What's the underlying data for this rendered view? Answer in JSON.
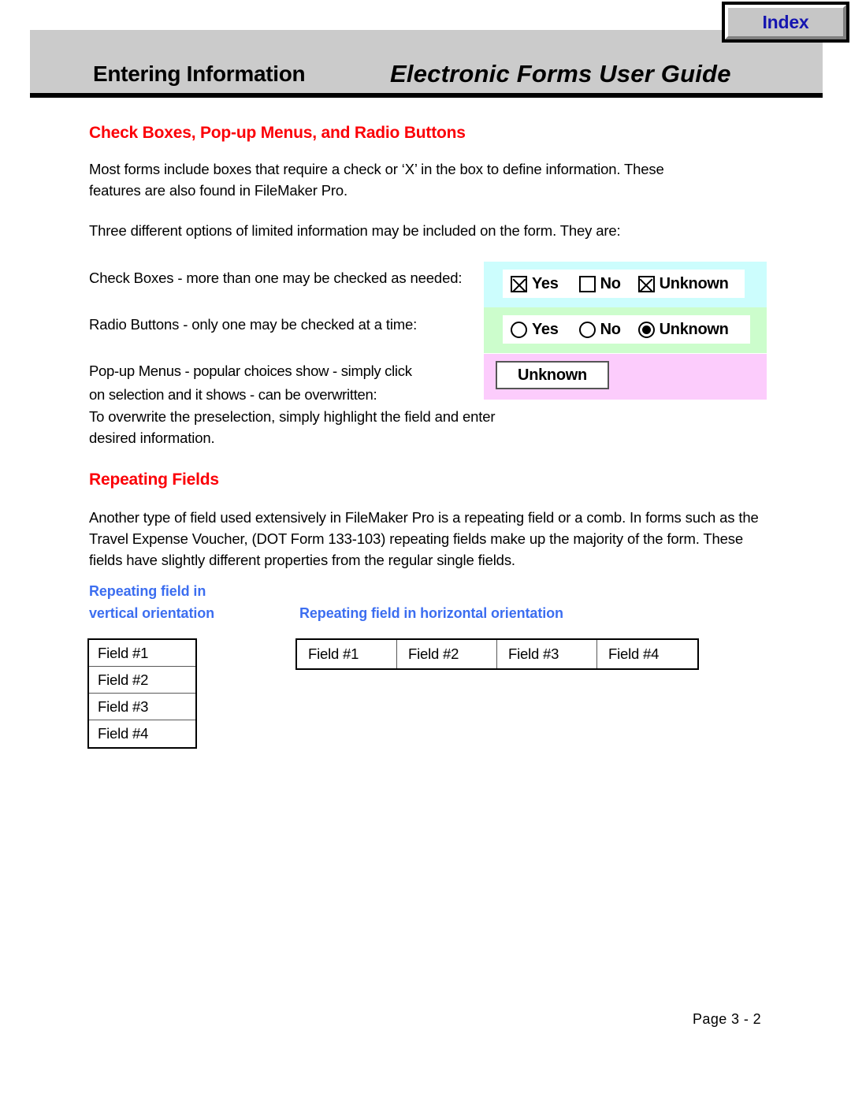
{
  "header": {
    "section_title": "Entering Information",
    "guide_title": "Electronic Forms User Guide",
    "index_button_label": "Index"
  },
  "main": {
    "section1_heading": "Check Boxes, Pop-up Menus, and Radio Buttons",
    "para1": "Most forms include boxes that require a check or ‘X’ in the box to define information. These features are also found in FileMaker Pro.",
    "para2": "Three different options of limited information may be included on the form. They are:",
    "label_checkboxes": "Check Boxes - more than one may be checked as needed:",
    "label_radio": "Radio Buttons - only one may be checked at a time:",
    "label_popup": "Pop-up Menus - popular choices show - simply click\non selection and it shows  - can be overwritten:",
    "para3": "To overwrite the preselection, simply highlight the field and enter desired information.",
    "section2_heading": "Repeating Fields",
    "para4": "Another type of field used extensively in FileMaker Pro is a repeating field or a comb. In forms such as the Travel Expense Voucher, (DOT Form 133-103) repeating fields make up the majority of the form. These fields have slightly different properties from the regular single fields.",
    "vertical_heading_line1": "Repeating field in",
    "vertical_heading_line2": "vertical orientation",
    "horizontal_heading": "Repeating field in horizontal orientation"
  },
  "widgets": {
    "checkbox_panel": {
      "background_color": "#ccfdfd",
      "options": [
        {
          "label": "Yes",
          "checked": true
        },
        {
          "label": "No",
          "checked": false
        },
        {
          "label": "Unknown",
          "checked": true
        }
      ]
    },
    "radio_panel": {
      "background_color": "#ccfdcc",
      "options": [
        {
          "label": "Yes",
          "selected": false
        },
        {
          "label": "No",
          "selected": false
        },
        {
          "label": "Unknown",
          "selected": true
        }
      ]
    },
    "popup_panel": {
      "background_color": "#fcccfc",
      "selected_value": "Unknown"
    }
  },
  "tables": {
    "vertical_fields": [
      "Field #1",
      "Field #2",
      "Field #3",
      "Field #4"
    ],
    "horizontal_fields": [
      "Field #1",
      "Field #2",
      "Field #3",
      "Field #4"
    ]
  },
  "footer": {
    "page_number": "Page  3 - 2"
  },
  "colors": {
    "heading_red": "#fb0007",
    "heading_blue": "#3c6ef0",
    "index_blue": "#1515b0",
    "header_gray": "#cbcbcb"
  }
}
